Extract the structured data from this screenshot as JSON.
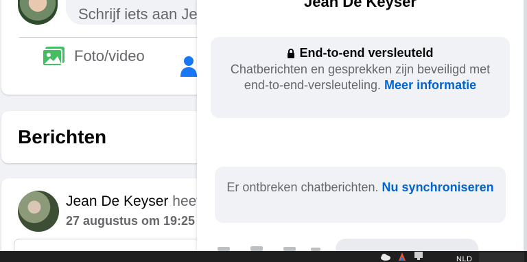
{
  "composer": {
    "placeholder": "Schrijf iets aan Je",
    "photo_video_label": "Foto/video"
  },
  "posts_section": {
    "title": "Berichten"
  },
  "post": {
    "author": "Jean De Keyser",
    "verb": "heeft",
    "date": "27 augustus om 19:25 ·"
  },
  "chat": {
    "title": "Jean De Keyser",
    "e2e": {
      "heading": "End-to-end versleuteld",
      "text": "Chatberichten en gesprekken zijn beveiligd met end-to-end-versleuteling.",
      "link": "Meer informatie"
    },
    "sync": {
      "text": "Er ontbreken chatberichten.",
      "link": "Nu synchroniseren"
    }
  },
  "taskbar": {
    "language": "NLD"
  },
  "colors": {
    "link": "#0064d1",
    "photo_icon": "#45bd62",
    "people_icon": "#1877f2",
    "secondary_text": "#65676b"
  }
}
